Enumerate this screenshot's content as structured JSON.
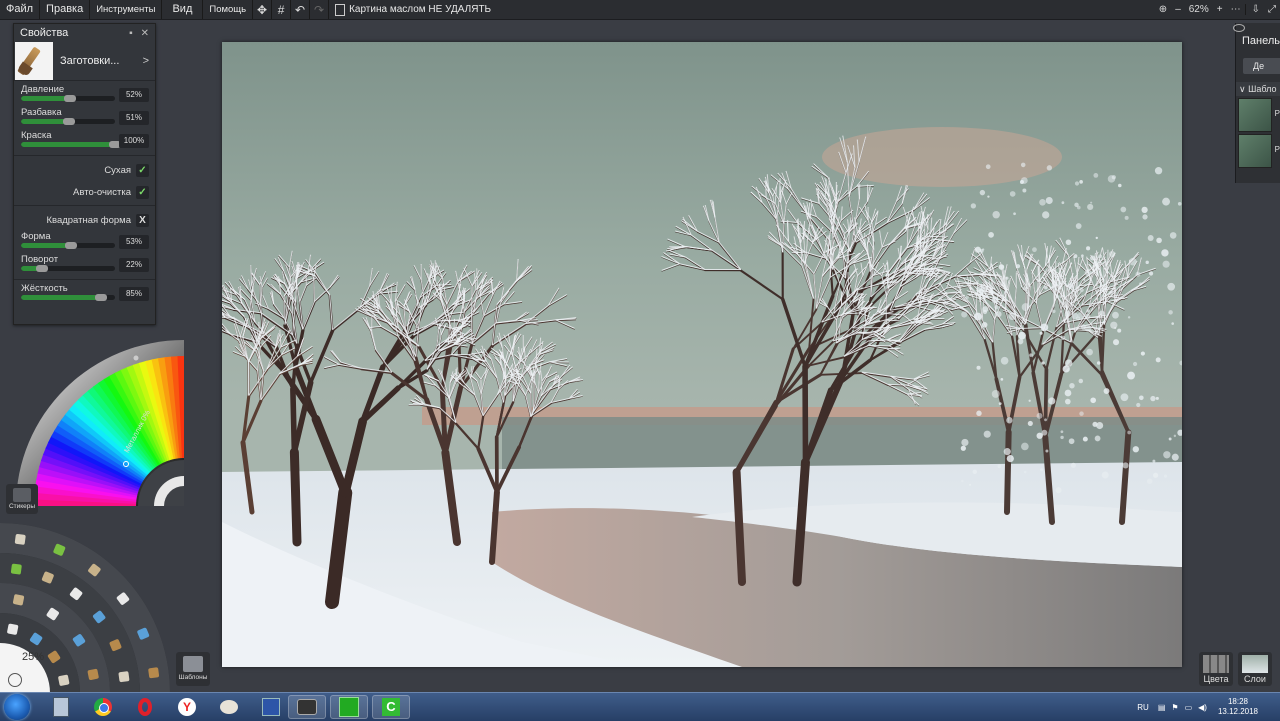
{
  "menu": {
    "items": [
      "Файл",
      "Правка",
      "Инструменты",
      "Вид",
      "Помощь"
    ],
    "document_title": "Картина маслом НЕ УДАЛЯТЬ",
    "zoom": "62%",
    "zoom_minus": "–",
    "zoom_plus": "+"
  },
  "properties": {
    "title": "Свойства",
    "preset_label": "Заготовки...",
    "preset_arrow": ">",
    "sliders_a": [
      {
        "label": "Давление",
        "value": "52%",
        "level": 52
      },
      {
        "label": "Разбавка",
        "value": "51%",
        "level": 51
      },
      {
        "label": "Краска",
        "value": "100%",
        "level": 100
      }
    ],
    "checks": [
      {
        "label": "Сухая",
        "mark": "✓"
      },
      {
        "label": "Авто-очистка",
        "mark": "✓"
      }
    ],
    "square_label": "Квадратная форма",
    "square_mark": "X",
    "sliders_b": [
      {
        "label": "Форма",
        "value": "53%",
        "level": 53
      },
      {
        "label": "Поворот",
        "value": "22%",
        "level": 22
      }
    ],
    "hardness": {
      "label": "Жёсткость",
      "value": "85%",
      "level": 85
    }
  },
  "color_wheel": {
    "metallic_label": "Металлик 0%"
  },
  "tools": {
    "size_label": "25%"
  },
  "stickers_label": "Стикеры",
  "templates_label": "Шаблоны",
  "right_panel": {
    "title": "Панель",
    "button": "Де",
    "section": "Шабло",
    "row_label": "Р"
  },
  "bottom_right": {
    "colors_label": "Цвета",
    "layers_label": "Слои"
  },
  "taskbar": {
    "lang": "RU",
    "time": "18:28",
    "date": "13.12.2018"
  }
}
